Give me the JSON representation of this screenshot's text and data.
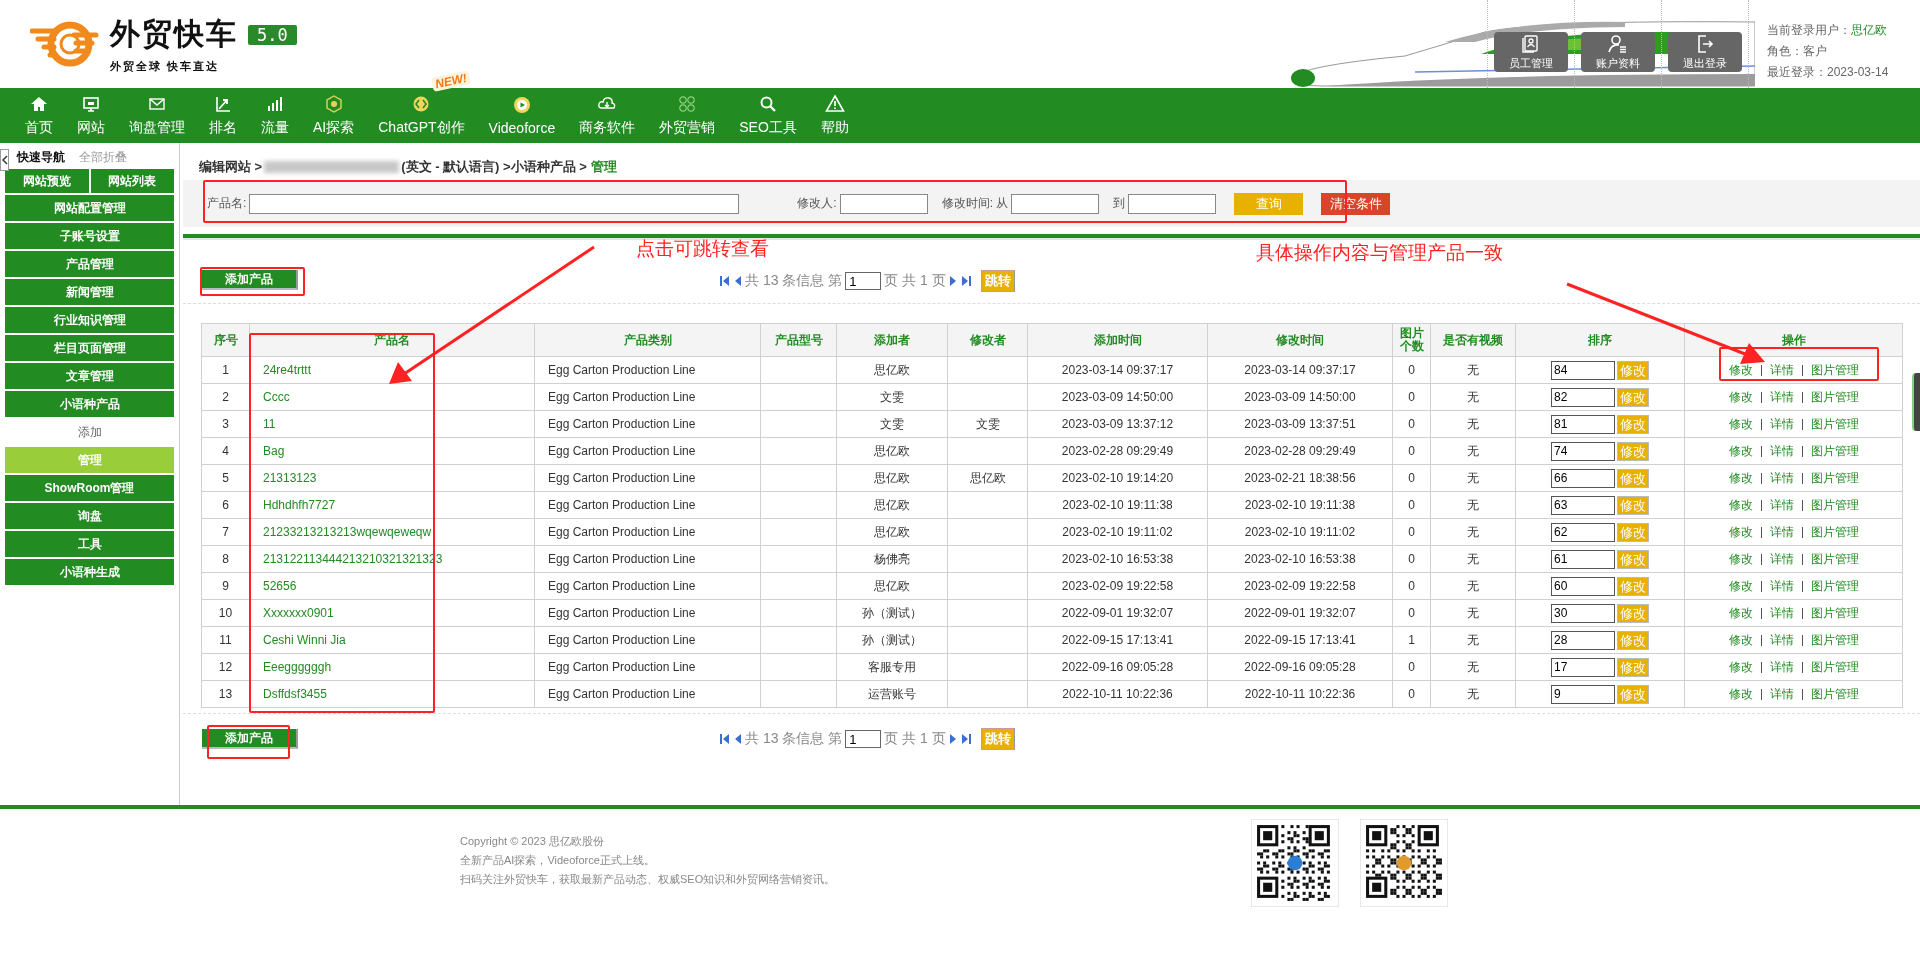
{
  "header": {
    "logo_title": "外贸快车",
    "version": "5.0",
    "slogan": "外贸全球 快车直达",
    "tools": [
      {
        "label": "员工管理"
      },
      {
        "label": "账户资料"
      },
      {
        "label": "退出登录"
      }
    ],
    "user": {
      "login_label": "当前登录用户：",
      "login_name": "思亿欧",
      "role": "角色：客户",
      "last_login": "最近登录：2023-03-14"
    }
  },
  "nav": {
    "items": [
      {
        "label": "首页"
      },
      {
        "label": "网站"
      },
      {
        "label": "询盘管理"
      },
      {
        "label": "排名"
      },
      {
        "label": "流量"
      },
      {
        "label": "AI探索"
      },
      {
        "label": "ChatGPT创作",
        "badge": "NEW!"
      },
      {
        "label": "Videoforce"
      },
      {
        "label": "商务软件"
      },
      {
        "label": "外贸营销"
      },
      {
        "label": "SEO工具"
      },
      {
        "label": "帮助"
      }
    ]
  },
  "sidebar": {
    "tabs": [
      {
        "label": "快速导航",
        "selected": true
      },
      {
        "label": "全部折叠",
        "selected": false
      }
    ],
    "quick_links": [
      "网站预览",
      "网站列表"
    ],
    "items": [
      {
        "label": "网站配置管理"
      },
      {
        "label": "子账号设置"
      },
      {
        "label": "产品管理"
      },
      {
        "label": "新闻管理"
      },
      {
        "label": "行业知识管理"
      },
      {
        "label": "栏目页面管理"
      },
      {
        "label": "文章管理"
      },
      {
        "label": "小语种产品",
        "children": [
          {
            "label": "添加",
            "selected": false
          },
          {
            "label": "管理",
            "selected": true
          }
        ]
      },
      {
        "label": "ShowRoom管理"
      },
      {
        "label": "询盘"
      },
      {
        "label": "工具"
      },
      {
        "label": "小语种生成"
      }
    ]
  },
  "breadcrumb": {
    "lead": "编辑网站 >",
    "trail": "(英文 - 默认语言) >小语种产品 >",
    "current": "管理"
  },
  "search": {
    "fields": [
      {
        "label": "产品名:",
        "kind": "wide"
      },
      {
        "label": "修改人:",
        "kind": "narrow"
      },
      {
        "label": "修改时间: 从",
        "kind": "narrow"
      },
      {
        "label": "到",
        "kind": "narrow"
      }
    ],
    "buttons": [
      {
        "label": "查询",
        "kind": "query"
      },
      {
        "label": "清空条件",
        "kind": "clear"
      }
    ]
  },
  "toolbars": [
    {
      "add_button": "添加产品",
      "pager": {
        "summary": "共 13 条信息 第",
        "page": "1",
        "total": "页 共 1 页",
        "go": "跳转"
      }
    },
    {
      "add_button": "添加产品",
      "pager": {
        "summary": "共 13 条信息 第",
        "page": "1",
        "total": "页 共 1 页",
        "go": "跳转"
      }
    }
  ],
  "table": {
    "columns": [
      "序号",
      "产品名",
      "产品类别",
      "产品型号",
      "添加者",
      "修改者",
      "添加时间",
      "修改时间",
      "图片个数",
      "是否有视频",
      "排序",
      "操作"
    ],
    "rows": [
      {
        "no": "1",
        "name": "24re4trttt",
        "category": "Egg Carton Production Line",
        "adder": "思亿欧",
        "added": "2023-03-14 09:37:17",
        "modified": "2023-03-14 09:37:17",
        "images": "0",
        "video": "无",
        "sort": "84",
        "sort_button": "修改",
        "actions": [
          "修改",
          "详情",
          "图片管理"
        ]
      },
      {
        "no": "2",
        "name": "Cccc",
        "category": "Egg Carton Production Line",
        "adder": "文雯",
        "added": "2023-03-09 14:50:00",
        "modified": "2023-03-09 14:50:00",
        "images": "0",
        "video": "无",
        "sort": "82",
        "sort_button": "修改",
        "actions": [
          "修改",
          "详情",
          "图片管理"
        ]
      },
      {
        "no": "3",
        "name": "11",
        "category": "Egg Carton Production Line",
        "adder": "文雯",
        "modifier": "文雯",
        "added": "2023-03-09 13:37:12",
        "modified": "2023-03-09 13:37:51",
        "images": "0",
        "video": "无",
        "sort": "81",
        "sort_button": "修改",
        "actions": [
          "修改",
          "详情",
          "图片管理"
        ]
      },
      {
        "no": "4",
        "name": "Bag",
        "category": "Egg Carton Production Line",
        "adder": "思亿欧",
        "added": "2023-02-28 09:29:49",
        "modified": "2023-02-28 09:29:49",
        "images": "0",
        "video": "无",
        "sort": "74",
        "sort_button": "修改",
        "actions": [
          "修改",
          "详情",
          "图片管理"
        ]
      },
      {
        "no": "5",
        "name": "21313123",
        "category": "Egg Carton Production Line",
        "adder": "思亿欧",
        "modifier": "思亿欧",
        "added": "2023-02-10 19:14:20",
        "modified": "2023-02-21 18:38:56",
        "images": "0",
        "video": "无",
        "sort": "66",
        "sort_button": "修改",
        "actions": [
          "修改",
          "详情",
          "图片管理"
        ]
      },
      {
        "no": "6",
        "name": "Hdhdhfh7727",
        "category": "Egg Carton Production Line",
        "adder": "思亿欧",
        "added": "2023-02-10 19:11:38",
        "modified": "2023-02-10 19:11:38",
        "images": "0",
        "video": "无",
        "sort": "63",
        "sort_button": "修改",
        "actions": [
          "修改",
          "详情",
          "图片管理"
        ]
      },
      {
        "no": "7",
        "name": "21233213213213wqewqeweqw",
        "category": "Egg Carton Production Line",
        "adder": "思亿欧",
        "added": "2023-02-10 19:11:02",
        "modified": "2023-02-10 19:11:02",
        "images": "0",
        "video": "无",
        "sort": "62",
        "sort_button": "修改",
        "actions": [
          "修改",
          "详情",
          "图片管理"
        ]
      },
      {
        "no": "8",
        "name": "213122113444213210321321323",
        "category": "Egg Carton Production Line",
        "adder": "杨佛亮",
        "added": "2023-02-10 16:53:38",
        "modified": "2023-02-10 16:53:38",
        "images": "0",
        "video": "无",
        "sort": "61",
        "sort_button": "修改",
        "actions": [
          "修改",
          "详情",
          "图片管理"
        ]
      },
      {
        "no": "9",
        "name": "52656",
        "category": "Egg Carton Production Line",
        "adder": "思亿欧",
        "added": "2023-02-09 19:22:58",
        "modified": "2023-02-09 19:22:58",
        "images": "0",
        "video": "无",
        "sort": "60",
        "sort_button": "修改",
        "actions": [
          "修改",
          "详情",
          "图片管理"
        ]
      },
      {
        "no": "10",
        "name": "Xxxxxxx0901",
        "category": "Egg Carton Production Line",
        "adder": "孙（测试）",
        "added": "2022-09-01 19:32:07",
        "modified": "2022-09-01 19:32:07",
        "images": "0",
        "video": "无",
        "sort": "30",
        "sort_button": "修改",
        "actions": [
          "修改",
          "详情",
          "图片管理"
        ]
      },
      {
        "no": "11",
        "name": "Ceshi Winni Jia",
        "category": "Egg Carton Production Line",
        "adder": "孙（测试）",
        "added": "2022-09-15 17:13:41",
        "modified": "2022-09-15 17:13:41",
        "images": "1",
        "video": "无",
        "sort": "28",
        "sort_button": "修改",
        "actions": [
          "修改",
          "详情",
          "图片管理"
        ]
      },
      {
        "no": "12",
        "name": "Eeeggggggh",
        "category": "Egg Carton Production Line",
        "adder": "客服专用",
        "added": "2022-09-16 09:05:28",
        "modified": "2022-09-16 09:05:28",
        "images": "0",
        "video": "无",
        "sort": "17",
        "sort_button": "修改",
        "actions": [
          "修改",
          "详情",
          "图片管理"
        ]
      },
      {
        "no": "13",
        "name": "Dsffdsf3455",
        "category": "Egg Carton Production Line",
        "adder": "运营账号",
        "added": "2022-10-11 10:22:36",
        "modified": "2022-10-11 10:22:36",
        "images": "0",
        "video": "无",
        "sort": "9",
        "sort_button": "修改",
        "actions": [
          "修改",
          "详情",
          "图片管理"
        ]
      }
    ]
  },
  "annotations": [
    {
      "text": "点击可跳转查看"
    },
    {
      "text": "具体操作内容与管理产品一致"
    }
  ],
  "footer": {
    "lines": [
      "Copyright © 2023 思亿欧股份",
      "全新产品AI探索，Videoforce正式上线。",
      "扫码关注外贸快车，获取最新产品动态、权威SEO知识和外贸网络营销资讯。"
    ]
  }
}
